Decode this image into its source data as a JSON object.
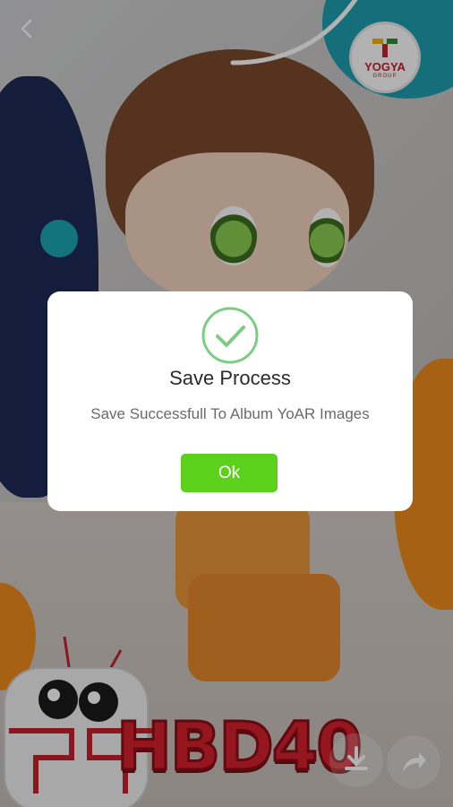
{
  "dialog": {
    "title": "Save Process",
    "message": "Save Successfull To Album YoAR Images",
    "ok_label": "Ok"
  },
  "logo": {
    "brand": "YOGYA",
    "sub": "GROUP"
  },
  "banner": {
    "text": "HBD40"
  },
  "icons": {
    "back": "back-arrow-icon",
    "check": "check-circle-icon",
    "download": "download-icon",
    "share": "share-icon"
  },
  "colors": {
    "accent_green": "#5bd11c",
    "check_green": "#66cc77",
    "brand_red": "#c8202b"
  }
}
